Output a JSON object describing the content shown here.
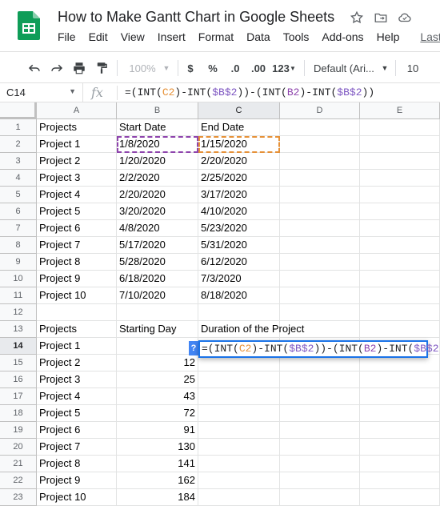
{
  "app": {
    "doc_title": "How to Make Gantt Chart in Google Sheets",
    "menu": [
      "File",
      "Edit",
      "View",
      "Insert",
      "Format",
      "Data",
      "Tools",
      "Add-ons",
      "Help"
    ],
    "last_edit": "Last e"
  },
  "toolbar": {
    "zoom": "100%",
    "currency": "$",
    "percent": "%",
    "dec_decrease": ".0",
    "dec_increase": ".00",
    "more_formats": "123",
    "font": "Default (Ari...",
    "font_size": "10"
  },
  "formula_bar": {
    "name_box": "C14",
    "fx_label": "fx",
    "formula": "=(INT(C2)-INT($B$2))-(INT(B2)-INT($B$2))"
  },
  "columns": [
    "A",
    "B",
    "C",
    "D",
    "E"
  ],
  "rows": [
    {
      "n": "1",
      "a": "Projects",
      "b": "Start Date",
      "c": "End Date"
    },
    {
      "n": "2",
      "a": "Project 1",
      "b": "1/8/2020",
      "c": "1/15/2020"
    },
    {
      "n": "3",
      "a": "Project 2",
      "b": "1/20/2020",
      "c": "2/20/2020"
    },
    {
      "n": "4",
      "a": "Project 3",
      "b": "2/2/2020",
      "c": "2/25/2020"
    },
    {
      "n": "5",
      "a": "Project 4",
      "b": "2/20/2020",
      "c": "3/17/2020"
    },
    {
      "n": "6",
      "a": "Project 5",
      "b": "3/20/2020",
      "c": "4/10/2020"
    },
    {
      "n": "7",
      "a": "Project 6",
      "b": "4/8/2020",
      "c": "5/23/2020"
    },
    {
      "n": "8",
      "a": "Project 7",
      "b": "5/17/2020",
      "c": "5/31/2020"
    },
    {
      "n": "9",
      "a": "Project 8",
      "b": "5/28/2020",
      "c": "6/12/2020"
    },
    {
      "n": "10",
      "a": "Project 9",
      "b": "6/18/2020",
      "c": "7/3/2020"
    },
    {
      "n": "11",
      "a": "Project 10",
      "b": "7/10/2020",
      "c": "8/18/2020"
    },
    {
      "n": "12",
      "a": "",
      "b": "",
      "c": ""
    },
    {
      "n": "13",
      "a": "Projects",
      "b": "Starting Day",
      "c": "Duration of the Project"
    },
    {
      "n": "14",
      "a": "Project 1",
      "b": "",
      "c": ""
    },
    {
      "n": "15",
      "a": "Project 2",
      "b": "12",
      "c": ""
    },
    {
      "n": "16",
      "a": "Project 3",
      "b": "25",
      "c": ""
    },
    {
      "n": "17",
      "a": "Project 4",
      "b": "43",
      "c": ""
    },
    {
      "n": "18",
      "a": "Project 5",
      "b": "72",
      "c": ""
    },
    {
      "n": "19",
      "a": "Project 6",
      "b": "91",
      "c": ""
    },
    {
      "n": "20",
      "a": "Project 7",
      "b": "130",
      "c": ""
    },
    {
      "n": "21",
      "a": "Project 8",
      "b": "141",
      "c": ""
    },
    {
      "n": "22",
      "a": "Project 9",
      "b": "162",
      "c": ""
    },
    {
      "n": "23",
      "a": "Project 10",
      "b": "184",
      "c": ""
    }
  ],
  "editor": {
    "help_badge": "?",
    "parts": [
      "=(INT(",
      "C2",
      ")-INT(",
      "$B$2",
      "))-(INT(",
      "B2",
      ")-INT(",
      "$B$2",
      "))"
    ]
  },
  "colors": {
    "accent": "#1a73e8",
    "ref_c2": "#e69138",
    "ref_b": "#8e44ad",
    "sheets_green": "#0f9d58"
  }
}
